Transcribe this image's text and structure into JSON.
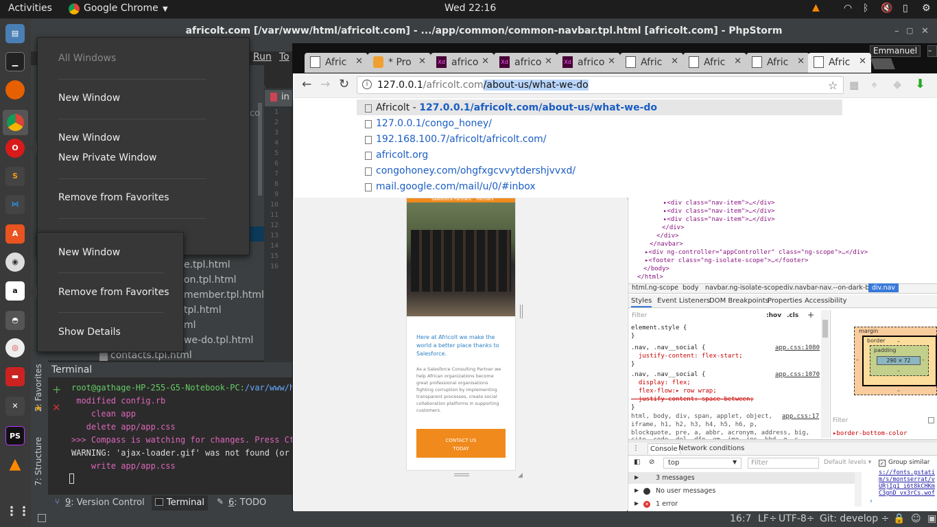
{
  "top_panel": {
    "activities": "Activities",
    "app_menu": "Google Chrome",
    "clock": "Wed 22:16"
  },
  "launcher_icons": [
    "files-icon",
    "terminal-icon",
    "firefox-icon",
    "chrome-icon",
    "opera-icon",
    "sublime-icon",
    "vscode-icon",
    "software-center-icon",
    "disk-icon",
    "amazon-icon",
    "gimp-icon",
    "help-icon",
    "monitor-icon",
    "tools-icon",
    "phpstorm-icon",
    "vlc-icon",
    "apps-grid-icon"
  ],
  "phpstorm": {
    "title": "africolt.com [/var/www/html/africolt.com] - .../app/common/common-navbar.tpl.html [africolt.com] - PhpStorm",
    "menu": {
      "run": "Run",
      "tools": "To"
    },
    "editor_tab": "in",
    "fragment_co": "co",
    "line_numbers": [
      "1",
      "2",
      "3",
      "4",
      "5",
      "6",
      "7",
      "8",
      "9",
      "10",
      "11",
      "12",
      "13",
      "14",
      "15",
      "16"
    ],
    "files": [
      "e.tpl.html",
      "on.tpl.html",
      "member.tpl.html",
      "tpl.html",
      "ml",
      "we-do.tpl.html",
      "contacts.tpl.html"
    ],
    "terminal_title": "Terminal",
    "terminal_lines": [
      {
        "text": "root@gathage-HP-255-G5-Notebook-PC:",
        "path": "/var/www/ht"
      },
      {
        "text": " modified config.rb"
      },
      {
        "text": "    clean app"
      },
      {
        "text": "   delete app/app.css"
      },
      {
        "text": ">>> Compass is watching for changes. Press Ctr"
      },
      {
        "text": "WARNING: 'ajax-loader.gif' was not found (or c"
      },
      {
        "text": "    write app/app.css"
      }
    ],
    "side_labels": {
      "favorites": "2: Favorites",
      "structure": "7: Structure"
    },
    "bottom_tabs": [
      {
        "num": "9",
        "label": ": Version Control"
      },
      {
        "num": "",
        "label": "Terminal"
      },
      {
        "num": "6",
        "label": ": TODO"
      }
    ],
    "status": {
      "position": "16:7",
      "lf": "LF÷",
      "encoding": "UTF-8÷",
      "git": "Git: develop ÷"
    }
  },
  "context_menu_1": {
    "header": "All Windows",
    "items": [
      "New Window",
      "New Window",
      "New Private Window",
      "Remove from Favorites"
    ]
  },
  "context_menu_2": {
    "items": [
      "New Window",
      "Remove from Favorites",
      "Show Details"
    ]
  },
  "chrome": {
    "profile": "Emmanuel",
    "tabs": [
      {
        "title": "Afric",
        "icon": "page"
      },
      {
        "title": "* Pro",
        "icon": "orange"
      },
      {
        "title": "africo",
        "icon": "xd"
      },
      {
        "title": "africo",
        "icon": "xd"
      },
      {
        "title": "africo",
        "icon": "xd"
      },
      {
        "title": "Afric",
        "icon": "page"
      },
      {
        "title": "Afric",
        "icon": "page"
      },
      {
        "title": "Afric",
        "icon": "page"
      },
      {
        "title": "Afric",
        "icon": "page"
      }
    ],
    "url_host": "127.0.0.1",
    "url_path1": "/africolt.com",
    "url_selected": "/about-us/what-we-do",
    "suggestions": [
      {
        "prefix": "Africolt - ",
        "url": "127.0.0.1/africolt.com/about-us/what-we-do"
      },
      {
        "prefix": "",
        "url": "127.0.0.1/congo_honey/"
      },
      {
        "prefix": "",
        "url": "192.168.100.7/africolt/africolt.com/"
      },
      {
        "prefix": "",
        "url": "africolt.org"
      },
      {
        "prefix": "",
        "url": "congohoney.com/ohgfxgcvvytdershjvvxd/"
      },
      {
        "prefix": "",
        "url": "mail.google.com/mail/u/0/#inbox"
      }
    ]
  },
  "phone_page": {
    "nav_text": "Salesforce Partners    Partners",
    "headline": "Here at Africolt we make the world a better place thanks to Salesforce.",
    "body": "As a Salesforce Consulting Partner we help African organizations become great professional organisations fighting corruption by implementing transparent processes, create social collaboration platforms in supporting customers.",
    "cta": "CONTACT US TODAY"
  },
  "devtools": {
    "dom_lines": [
      "▸<div class=\"nav-item\">…</div>",
      "▸<div class=\"nav-item\">…</div>",
      "▸<div class=\"nav-item\">…</div>",
      "</div>",
      "</div>",
      "</navbar>",
      "▸<div ng-controller=\"appController\" class=\"ng-scope\">…</div>",
      "▸<footer class=\"ng-isolate-scope\">…</footer>",
      "</body>",
      "</html>"
    ],
    "breadcrumbs": [
      "html.ng-scope",
      "body",
      "navbar.ng-isolate-scope",
      "div.navbar-nav.--on-dark-bg",
      "div.nav"
    ],
    "panel_tabs": [
      "Styles",
      "Event Listeners",
      "DOM Breakpoints",
      "Properties",
      "Accessibility"
    ],
    "filter_placeholder": "Filter",
    "hov": ":hov",
    "cls": ".cls",
    "style_lines": [
      "element.style {",
      "}",
      ".nav, .nav__social {",
      "  justify-content: flex-start;",
      "}",
      ".nav, .nav__social {",
      "  display: flex;",
      "  flex-flow:▸ row wrap;",
      "  justify-content: space-between;",
      "}",
      "html, body, div, span, applet, object,",
      "iframe, h1, h2, h3, h4, h5, h6, p,",
      "blockquote, pre, a, abbr, acronym, address, big,",
      "cite, code, del, dfn, em, img, ins, kbd, q, s,"
    ],
    "style_sources": [
      "app.css:1080",
      "app.css:1070",
      "app.css:17"
    ],
    "box_model": {
      "margin": "margin",
      "border": "border",
      "padding": "padding",
      "content": "290 × 72",
      "dash": "–"
    },
    "computed_filter": "Filter",
    "computed_prop": "border-bottom-color",
    "drawer_tabs": [
      "Console",
      "Network conditions"
    ],
    "context": "top",
    "console_filter": "Filter",
    "levels": "Default levels ▾",
    "group_similar": "Group similar",
    "messages": [
      "3 messages",
      "No user messages",
      "1 error"
    ],
    "link_text": [
      "s://fonts.gstati",
      "m/s/montserrat/v",
      "URjIg1 i6t8kCHKm",
      "C3gnD vx3rCs.wof"
    ]
  }
}
